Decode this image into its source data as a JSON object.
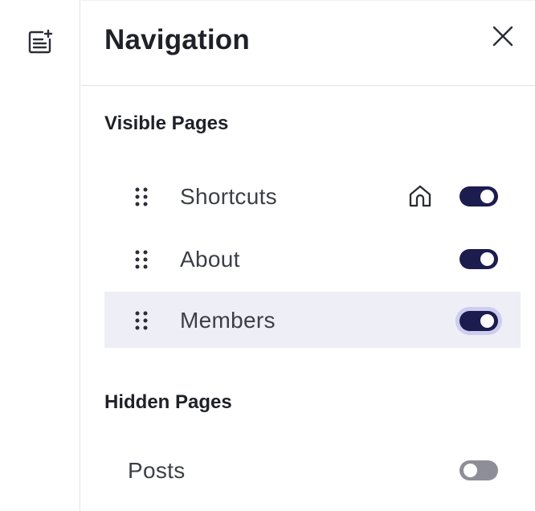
{
  "rail": {
    "add_page_icon": "document-add-icon"
  },
  "panel": {
    "title": "Navigation",
    "close_icon": "close-icon"
  },
  "visible_section": {
    "title": "Visible Pages",
    "items": [
      {
        "label": "Shortcuts",
        "is_home": true,
        "enabled": true,
        "active": false
      },
      {
        "label": "About",
        "is_home": false,
        "enabled": true,
        "active": false
      },
      {
        "label": "Members",
        "is_home": false,
        "enabled": true,
        "active": true
      }
    ]
  },
  "hidden_section": {
    "title": "Hidden Pages",
    "items": [
      {
        "label": "Posts",
        "enabled": false
      }
    ]
  },
  "colors": {
    "toggle_on": "#1c1c4e",
    "toggle_off": "#8e8e99",
    "active_row": "#eeeef6",
    "focus_ring": "#cdcdf0"
  }
}
